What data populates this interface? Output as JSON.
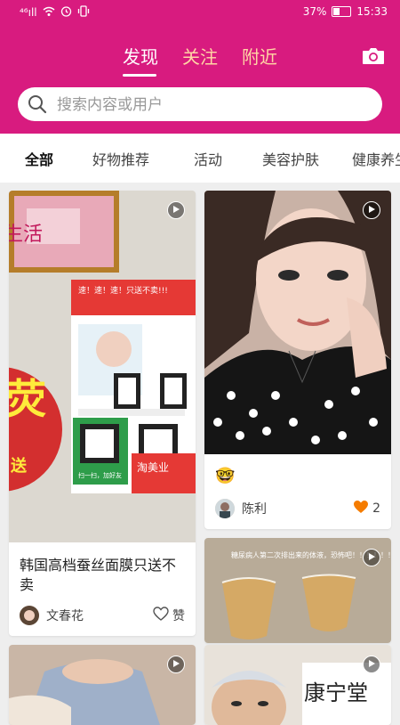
{
  "status_bar": {
    "signal": "⁴⁶ıll",
    "battery_text": "37%",
    "battery_level": 0.37,
    "time": "15:33"
  },
  "tabs": [
    "发现",
    "关注",
    "附近"
  ],
  "active_tab": "发现",
  "search": {
    "placeholder": "搜索内容或用户"
  },
  "categories": [
    "全部",
    "好物推荐",
    "活动",
    "美容护肤",
    "健康养生"
  ],
  "cards": [
    {
      "title": "韩国高档蚕丝面膜只送不卖",
      "author": "文春花",
      "like_label": "赞"
    },
    {
      "title": "🤓",
      "author": "陈利",
      "likes": "2"
    }
  ],
  "poster_texts": {
    "c1_top": "生活",
    "c1_poster_header": "速！速！速！只送不卖!!!",
    "c1_red_big": "荧",
    "c1_red_small": "送",
    "c1_sign": "淘美业",
    "c1_step": "扫一扫，加好友",
    "c3_caption": "糖尿病人第二次排出来的体液，恐怖吧！！！！！！",
    "c4_sign": "康宁堂"
  },
  "colors": {
    "brand": "#d81b7f",
    "tab_inactive": "#ffd6a5",
    "like": "#f57c00"
  }
}
